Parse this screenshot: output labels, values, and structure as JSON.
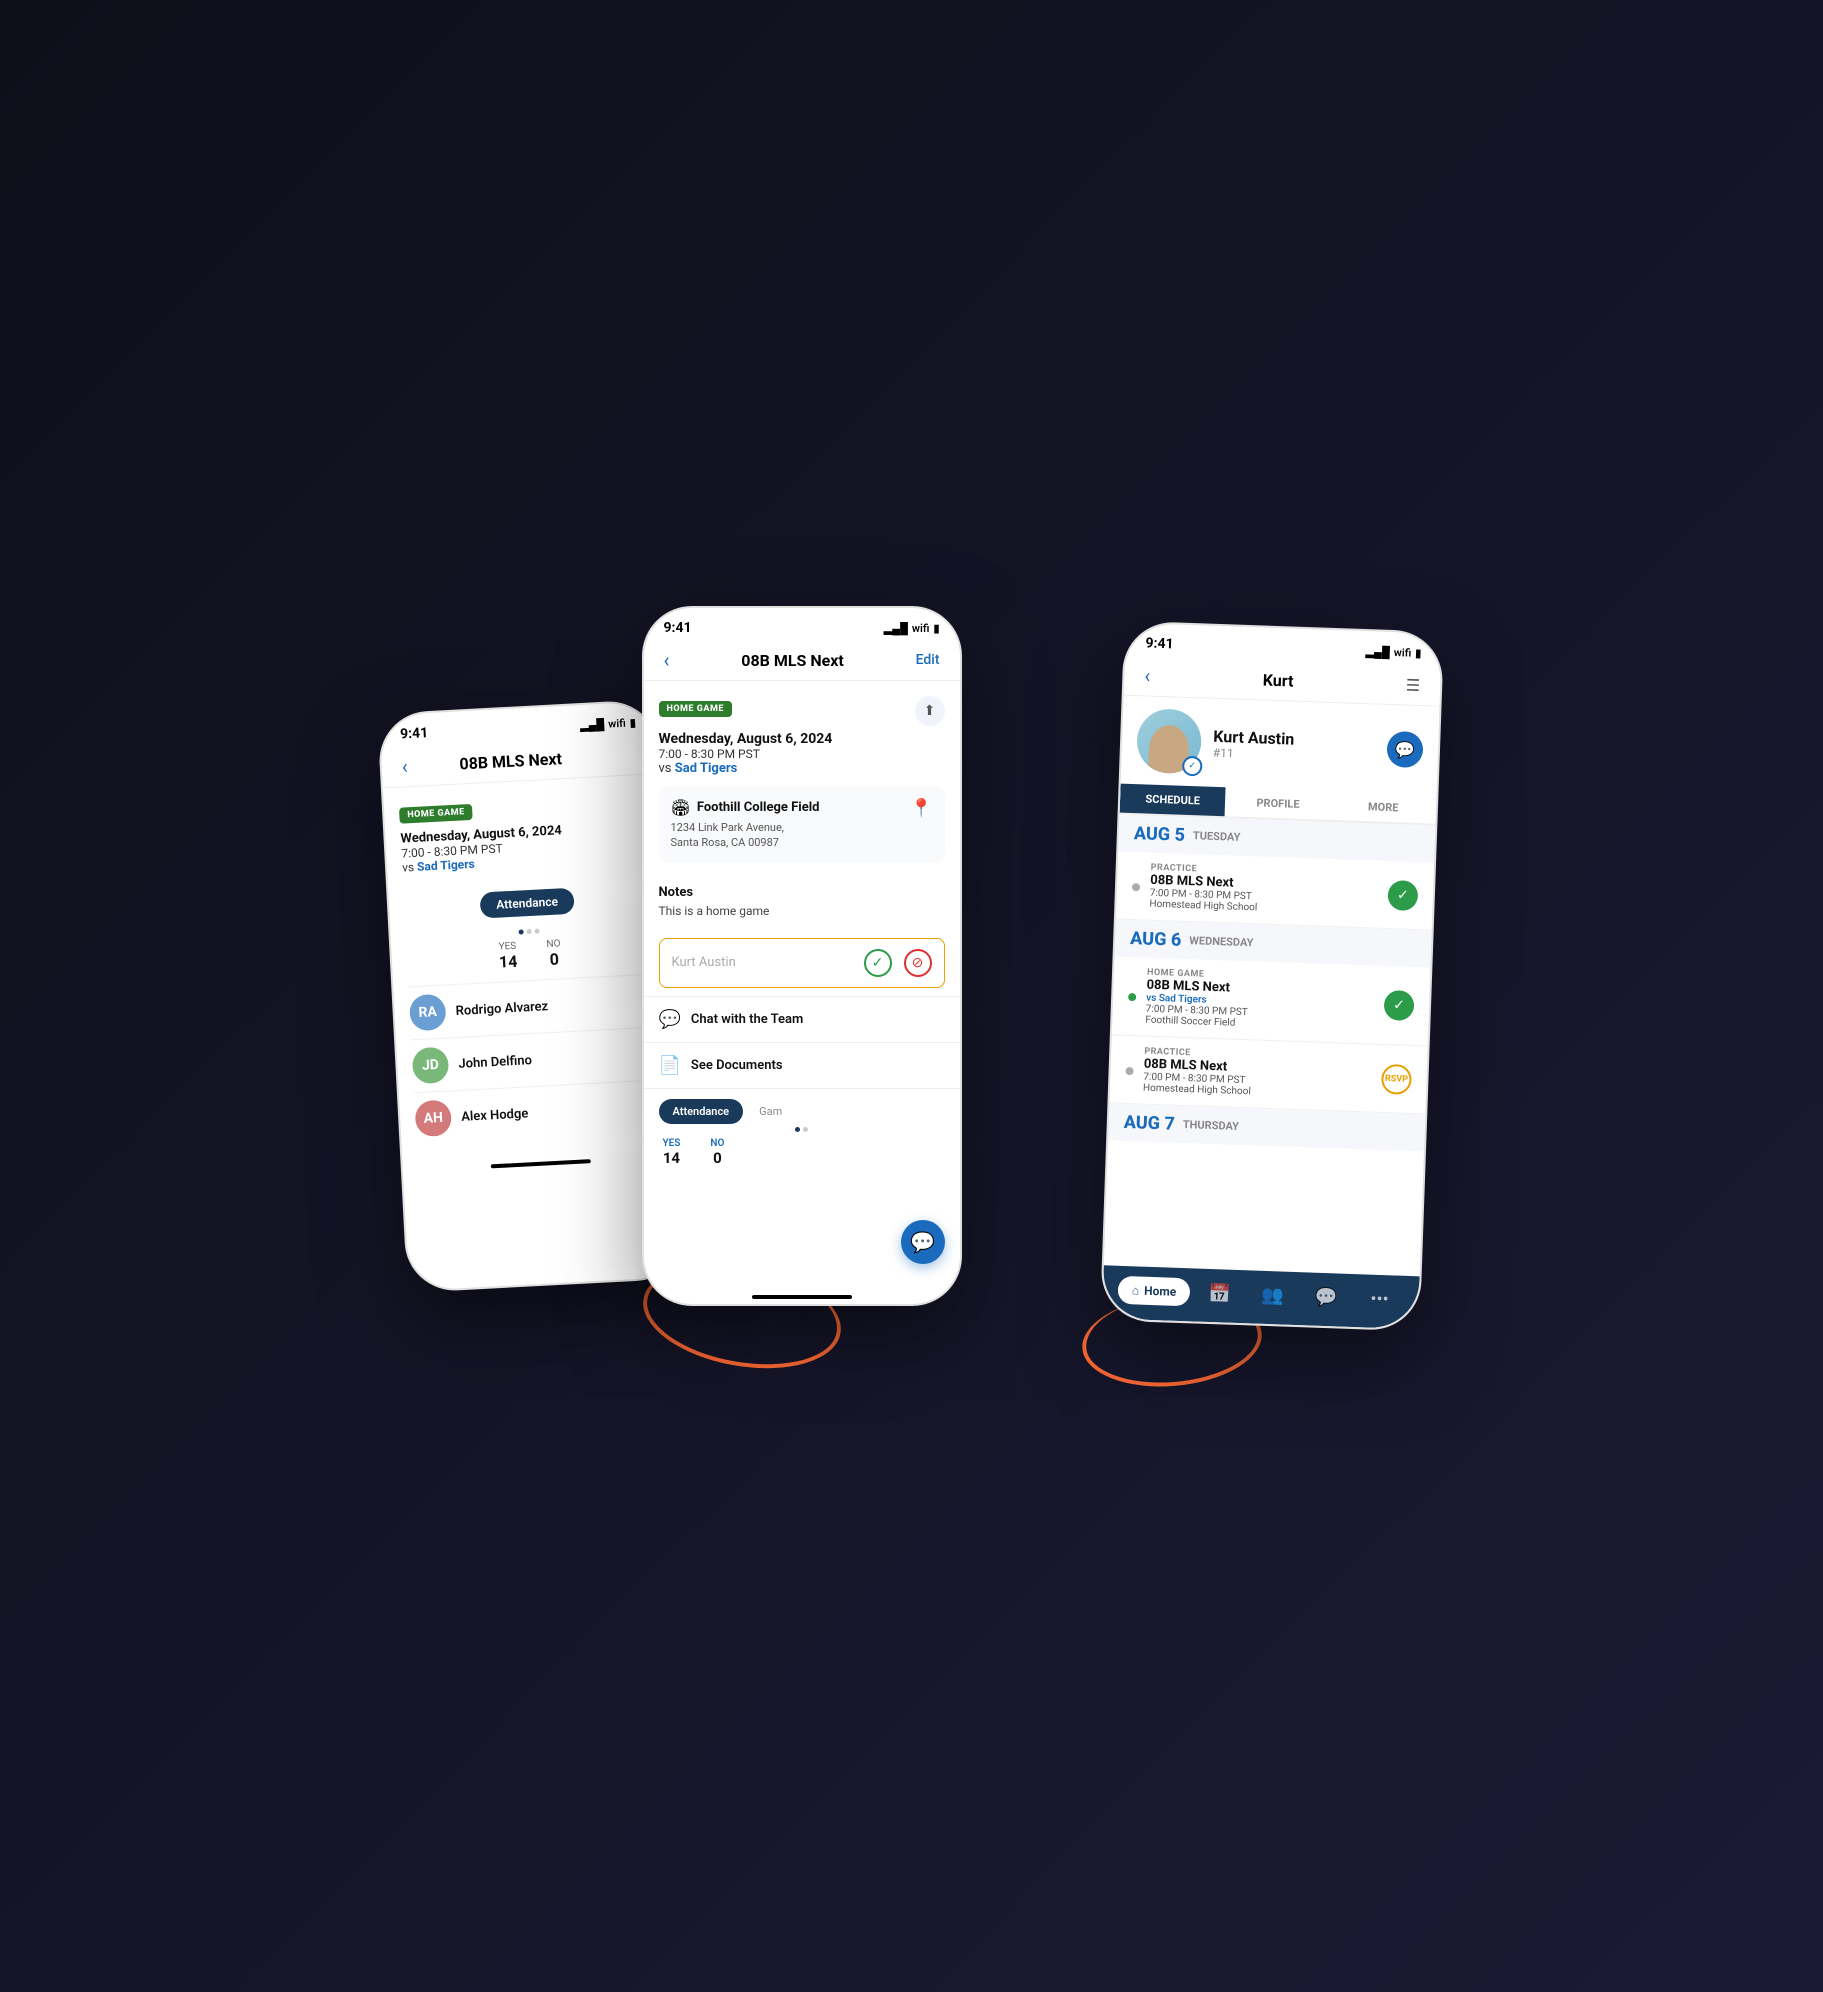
{
  "scene": {
    "phones": {
      "left": {
        "status_time": "9:41",
        "nav_title": "08B MLS Next",
        "badge": "HOME GAME",
        "game_date": "Wednesday, August 6, 2024",
        "game_time": "7:00 - 8:30 PM PST",
        "game_vs": "vs Sad Tigers",
        "attendance_label": "Attendance",
        "yes_label": "YES",
        "yes_count": "14",
        "no_label": "NO",
        "no_count": "0",
        "players": [
          {
            "name": "Rodrigo Alvarez",
            "initials": "RA",
            "color": "#6b9fd4"
          },
          {
            "name": "John Delfino",
            "initials": "JD",
            "color": "#7ab87a"
          },
          {
            "name": "Alex Hodge",
            "initials": "AH",
            "color": "#d47a7a"
          }
        ]
      },
      "center": {
        "status_time": "9:41",
        "nav_title": "08B MLS Next",
        "nav_edit": "Edit",
        "badge": "HOME GAME",
        "game_date": "Wednesday, August 6, 2024",
        "game_time": "7:00 - 8:30 PM PST",
        "game_vs": "vs Sad Tigers",
        "location_name": "Foothill College Field",
        "location_addr": "1234 Link Park Avenue,\nSanta Rosa, CA 00987",
        "notes_label": "Notes",
        "notes_text": "This is a home game",
        "rsvp_placeholder": "Kurt Austin",
        "chat_label": "Chat with the Team",
        "docs_label": "See Documents",
        "attendance_label": "Attendance",
        "game_tab_label": "Gam",
        "yes_label": "YES",
        "yes_count": "14",
        "no_label": "NO",
        "no_count": "0"
      },
      "right": {
        "status_time": "9:41",
        "nav_title": "Kurt",
        "profile_name": "Kurt Austin",
        "profile_num": "#11",
        "tab_schedule": "SCHEDULE",
        "tab_profile": "PROFILE",
        "tab_more": "MORE",
        "aug5_day": "AUG 5",
        "aug5_weekday": "TUESDAY",
        "aug5_events": [
          {
            "type": "PRACTICE",
            "name": "08B MLS Next",
            "time": "7:00 PM - 8:30 PM PST",
            "location": "Homestead High School",
            "status": "check",
            "dot": "gray"
          }
        ],
        "aug6_day": "AUG 6",
        "aug6_weekday": "WEDNESDAY",
        "aug6_events": [
          {
            "type": "HOME GAME",
            "name": "08B MLS Next",
            "vs": "vs Sad Tigers",
            "time": "7:00 PM - 8:30 PM PST",
            "location": "Foothill Soccer Field",
            "status": "check",
            "dot": "green"
          },
          {
            "type": "PRACTICE",
            "name": "08B MLS Next",
            "time": "7:00 PM - 8:30 PM PST",
            "location": "Homestead High School",
            "status": "rsvp",
            "dot": "gray"
          }
        ],
        "aug7_day": "AUG 7",
        "aug7_weekday": "THURSDAY",
        "bottom_nav": {
          "home": "Home",
          "calendar": "📅",
          "team": "👥",
          "chat": "💬",
          "more": "•••"
        }
      }
    }
  }
}
